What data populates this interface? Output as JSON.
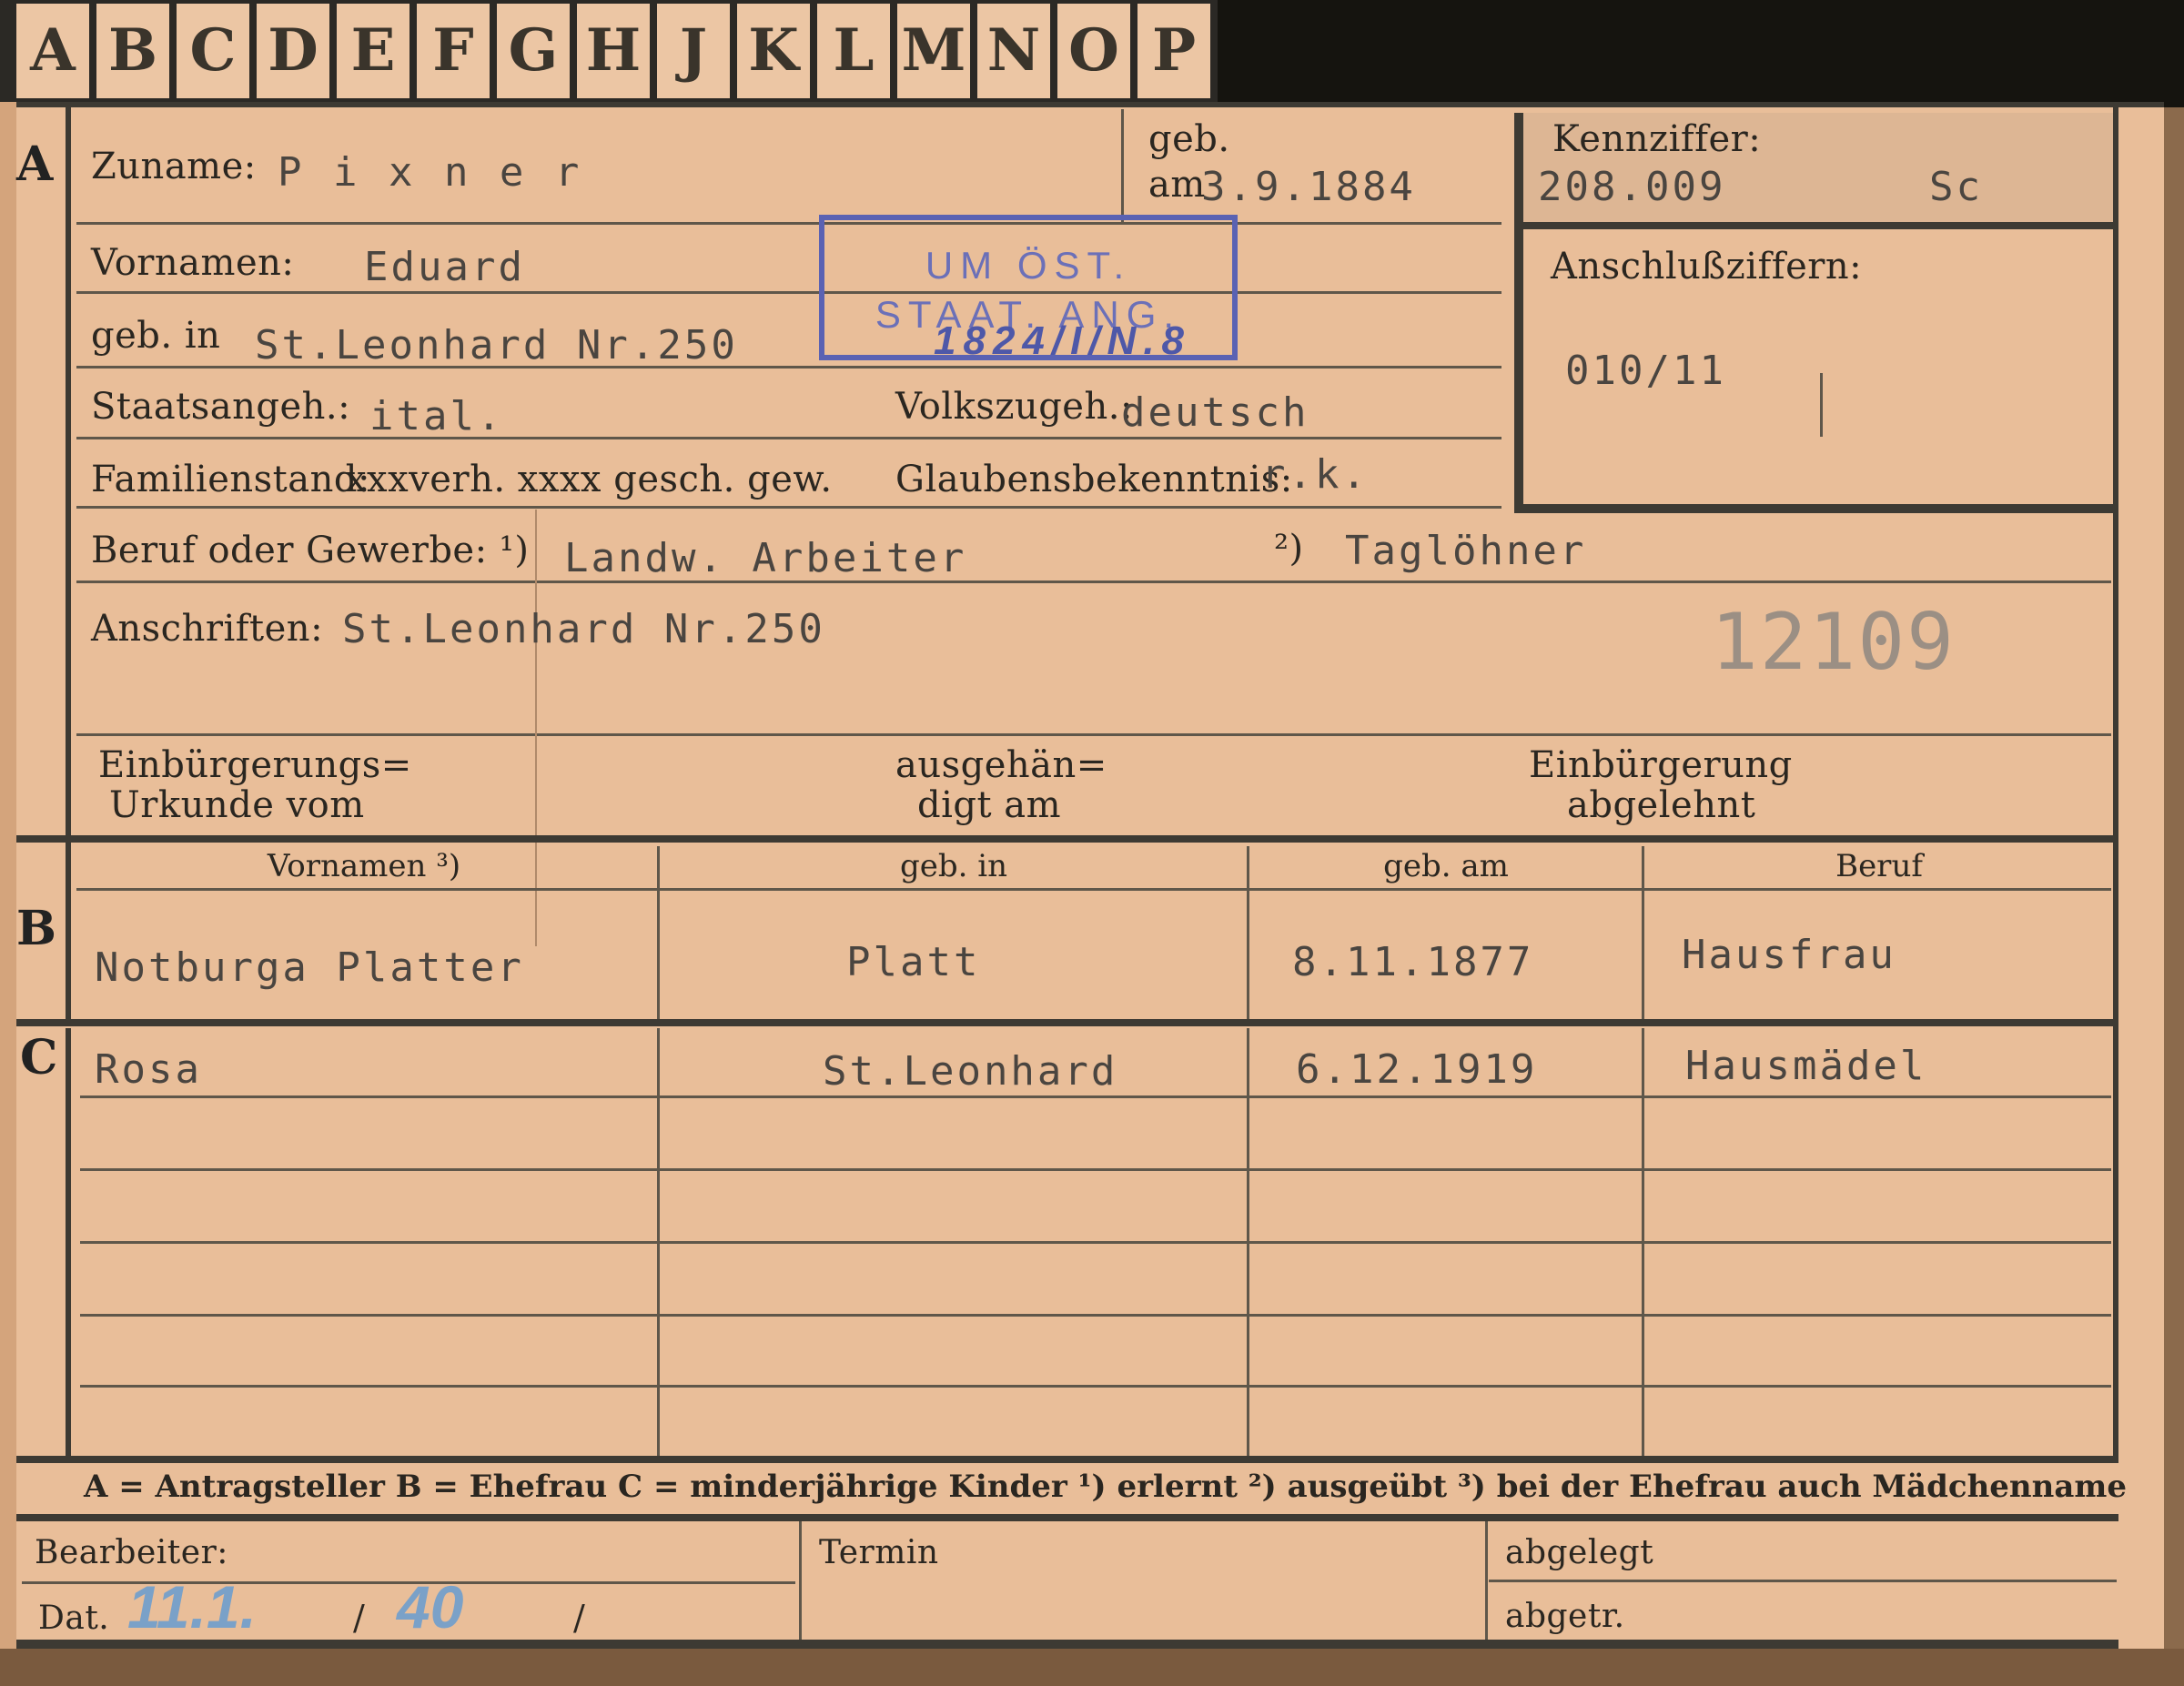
{
  "tabs": [
    "A",
    "B",
    "C",
    "D",
    "E",
    "F",
    "G",
    "H",
    "J",
    "K",
    "L",
    "M",
    "N",
    "O",
    "P"
  ],
  "section_a": {
    "marker": "A",
    "zuname_label": "Zuname:",
    "zuname_value": "P i x n e r",
    "geb_label": "geb.",
    "am_label": "am",
    "geb_am_value": "3.9.1884",
    "kennziffer_label": "Kennziffer:",
    "kennziffer_value": "208.009",
    "kennziffer_suffix": "Sc",
    "vornamen_label": "Vornamen:",
    "vornamen_value": "Eduard",
    "anschluss_label": "Anschlußziffern:",
    "anschluss_value": "010/11",
    "geb_in_label": "geb. in",
    "geb_in_value": "St.Leonhard Nr.250",
    "staatsangeh_label": "Staatsangeh.:",
    "staatsangeh_value": "ital.",
    "volkszugeh_label": "Volkszugeh.:",
    "volkszugeh_value": "deutsch",
    "familienstand_label": "Familienstand:",
    "familienstand_value": "xxxverh. xxxx gesch. gew.",
    "glauben_label": "Glaubensbekenntnis:",
    "glauben_value": "r.k.",
    "beruf_label": "Beruf oder Gewerbe: ¹)",
    "beruf_value_1": "Landw. Arbeiter",
    "beruf_mark_2": "²)",
    "beruf_value_2": "Taglöhner",
    "anschriften_label": "Anschriften:",
    "anschriften_value": "St.Leonhard Nr.250",
    "file_number": "12109",
    "einb_urkunde_line1": "Einbürgerungs=",
    "einb_urkunde_line2": "Urkunde vom",
    "ausgeh_line1": "ausgehän=",
    "ausgeh_line2": "digt am",
    "einb_abgelehnt_line1": "Einbürgerung",
    "einb_abgelehnt_line2": "abgelehnt"
  },
  "stamp": {
    "line1": "UM ÖST.",
    "line2": "STAAT. ANG.",
    "handwritten": "1824/I/N.8"
  },
  "section_b": {
    "marker": "B",
    "headers": [
      "Vornamen ³)",
      "geb. in",
      "geb. am",
      "Beruf"
    ],
    "row": [
      "Notburga Platter",
      "Platt",
      "8.11.1877",
      "Hausfrau"
    ]
  },
  "section_c": {
    "marker": "C",
    "rows": [
      [
        "Rosa",
        "St.Leonhard",
        "6.12.1919",
        "Hausmädel"
      ]
    ]
  },
  "legend_text": "A = Antragsteller   B = Ehefrau   C = minderjährige Kinder   ¹) erlernt   ²) ausgeübt   ³) bei der Ehefrau auch Mädchenname",
  "footer": {
    "bearbeiter_label": "Bearbeiter:",
    "dat_label": "Dat.",
    "dat_value_day": "11.1.",
    "dat_sep1": "/",
    "dat_value_year": "40",
    "dat_sep2": "/",
    "termin_label": "Termin",
    "abgelegt_label": "abgelegt",
    "abgetr_label": "abgetr."
  },
  "colors": {
    "card": "#e9be99",
    "ink": "#2a2620",
    "typewriter": "#4a4540",
    "stamp": "#5a62b3",
    "handwriting": "#7aa1c8"
  }
}
